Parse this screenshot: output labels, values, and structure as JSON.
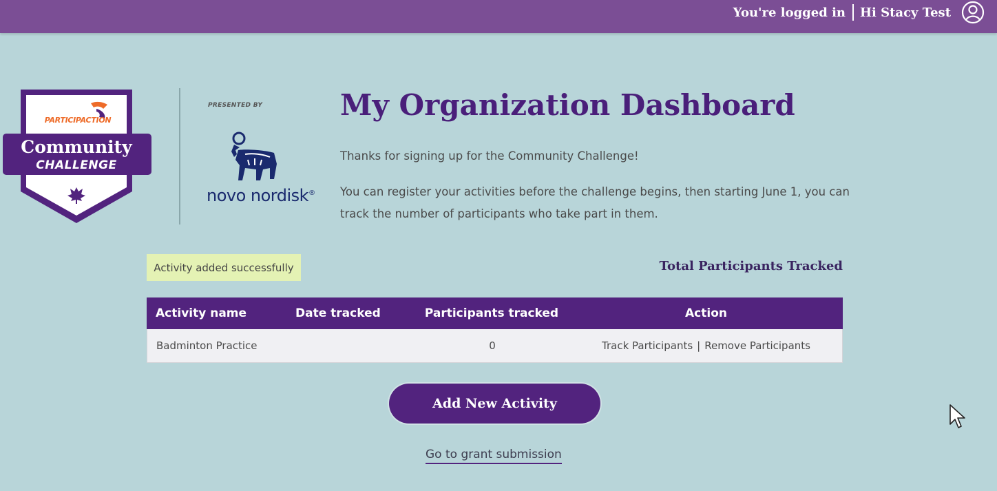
{
  "header": {
    "login_status": "You're logged in",
    "greeting": "Hi Stacy Test"
  },
  "badge": {
    "brand": "PARTICIPACTION",
    "title": "Community",
    "subtitle": "CHALLENGE"
  },
  "sponsor": {
    "presented_by": "PRESENTED BY",
    "name": "novo nordisk",
    "trademark": "®"
  },
  "main": {
    "title": "My Organization Dashboard",
    "intro_line1": "Thanks for signing up for the Community Challenge!",
    "intro_line2": "You can register your activities before the challenge begins, then starting June 1, you can track the number of participants who take part in them.",
    "toast": "Activity added successfully",
    "total_label": "Total Participants Tracked"
  },
  "table": {
    "headers": [
      "Activity name",
      "Date tracked",
      "Participants tracked",
      "Action"
    ],
    "rows": [
      {
        "activity": "Badminton Practice",
        "date": "",
        "participants": "0",
        "track_label": "Track Participants",
        "separator": "|",
        "remove_label": "Remove Participants"
      }
    ]
  },
  "actions": {
    "add_label": "Add New Activity",
    "grant_label": "Go to grant submission"
  },
  "colors": {
    "primary": "#52237e",
    "topbar": "#7b4e95",
    "background": "#b8d5d9",
    "accent": "#ee6b28",
    "toast_bg": "#e4f2b4"
  }
}
